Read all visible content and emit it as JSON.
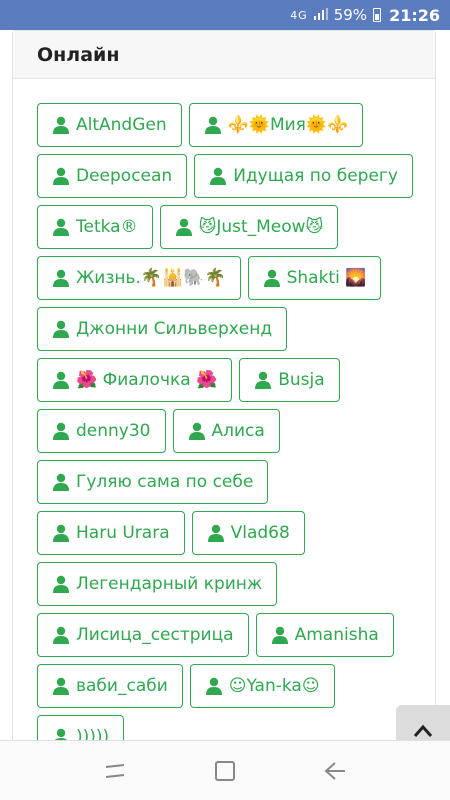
{
  "status_bar": {
    "signal": "4G",
    "battery": "59%",
    "time": "21:26"
  },
  "card": {
    "title": "Онлайн"
  },
  "users": [
    "AltAndGen",
    "⚜️🌞Мия🌞⚜️",
    "Deepocean",
    "Идущая по берегу",
    "Tetka®",
    "😼Just_Meow😼",
    "Жизнь.🌴🕌🐘🌴",
    "Shakti 🌄",
    "Джонни Сильверхенд",
    "🌺 Фиалочка 🌺",
    "Busja",
    "denny30",
    "Алиса",
    "Гуляю сама по себе",
    "Haru Urara",
    "Vlad68",
    "Легендарный кринж",
    "Лисица_сестрица",
    "Amanisha",
    "ваби_саби",
    "☺Yan-ka☺",
    ")))))"
  ],
  "icons": {
    "user": "user-icon",
    "scroll_top": "chevron-up-icon",
    "nav_recent": "recent-apps-icon",
    "nav_home": "home-icon",
    "nav_back": "back-icon"
  },
  "colors": {
    "accent": "#2fa84f",
    "status_bar": "#5b7dc0"
  }
}
